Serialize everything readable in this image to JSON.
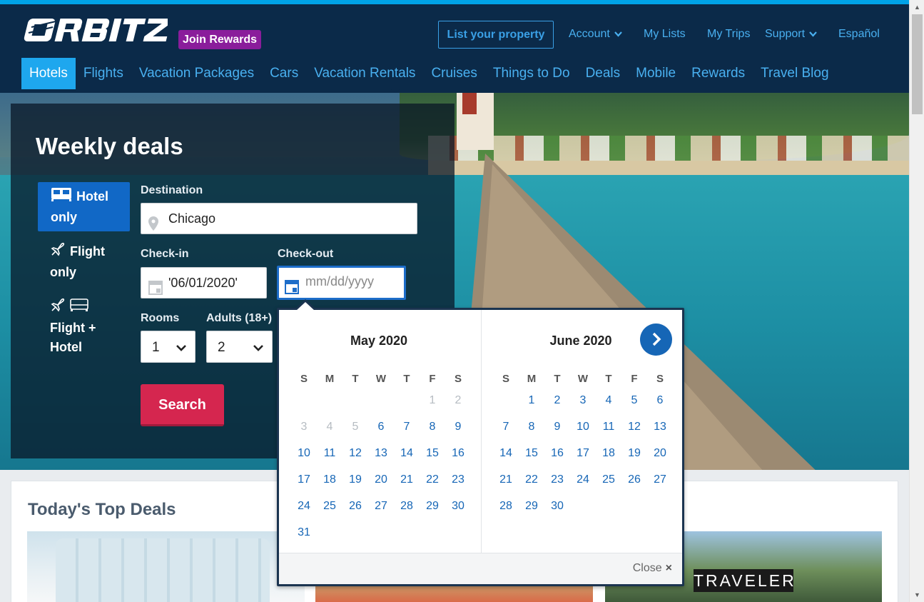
{
  "header": {
    "join_rewards": "Join Rewards",
    "list_property": "List your property",
    "account": "Account",
    "my_lists": "My Lists",
    "my_trips": "My Trips",
    "support": "Support",
    "language": "Español"
  },
  "nav": {
    "items": [
      "Hotels",
      "Flights",
      "Vacation Packages",
      "Cars",
      "Vacation Rentals",
      "Cruises",
      "Things to Do",
      "Deals",
      "Mobile",
      "Rewards",
      "Travel Blog"
    ],
    "active": "Hotels"
  },
  "search": {
    "title": "Weekly deals",
    "modes": {
      "hotel_only": "Hotel only",
      "flight_only": "Flight only",
      "flight_hotel": "Flight + Hotel"
    },
    "destination_label": "Destination",
    "destination_value": "Chicago",
    "checkin_label": "Check-in",
    "checkin_value": "'06/01/2020'",
    "checkout_label": "Check-out",
    "checkout_placeholder": "mm/dd/yyyy",
    "rooms_label": "Rooms",
    "rooms_value": "1",
    "adults_label": "Adults (18+)",
    "adults_value": "2",
    "search_button": "Search"
  },
  "calendar": {
    "weekdays": [
      "S",
      "M",
      "T",
      "W",
      "T",
      "F",
      "S"
    ],
    "months": [
      {
        "title": "May 2020",
        "first_weekday": 5,
        "days": 31,
        "disabled_through": 5
      },
      {
        "title": "June 2020",
        "first_weekday": 1,
        "days": 30,
        "disabled_through": 0
      }
    ],
    "next_label": "›",
    "close_label": "Close",
    "close_icon": "×"
  },
  "deals": {
    "title": "Today's Top Deals",
    "traveler_badge": "TRAVELER"
  },
  "colors": {
    "header_bg": "#0b2a49",
    "accent": "#00a3e8",
    "link": "#49b0f0",
    "search_button": "#d5264f",
    "rewards_badge": "#8a1d9b",
    "calendar_link": "#1666b6"
  }
}
